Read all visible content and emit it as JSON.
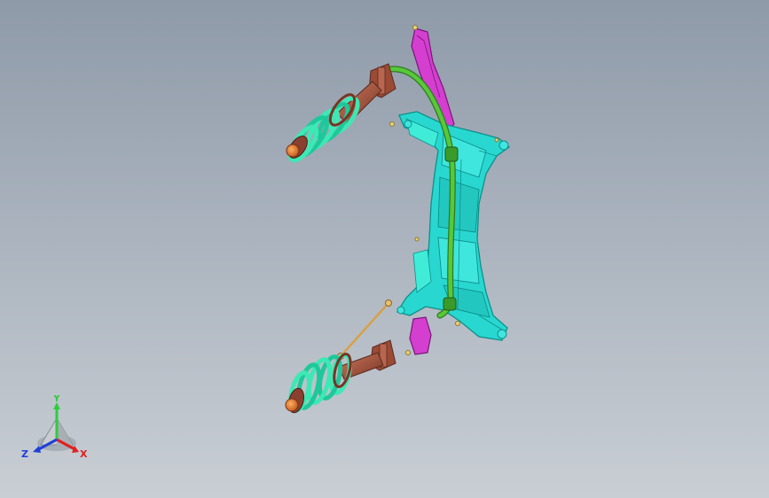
{
  "viewport": {
    "background_top": "#8f9aa9",
    "background_bottom": "#c9ced4"
  },
  "model": {
    "colors": {
      "subframe": "#28d8d0",
      "subframe_edge": "#0e8f8a",
      "side_rail": "#d43fd0",
      "stabilizer_bar": "#58c83a",
      "spring": "#3ee8b4",
      "spring_edge": "#0f8e6e",
      "strut_body": "#a8553f",
      "strut_edge": "#5a2a1e",
      "top_mount": "#e07a22",
      "end_link": "#d8a040",
      "bolt": "#e8d07a"
    }
  },
  "triad": {
    "y_label": "Y",
    "z_label": "Z",
    "x_label": "X",
    "y_color": "#2ecc40",
    "z_color": "#1f3fd8",
    "x_color": "#e0201e"
  }
}
